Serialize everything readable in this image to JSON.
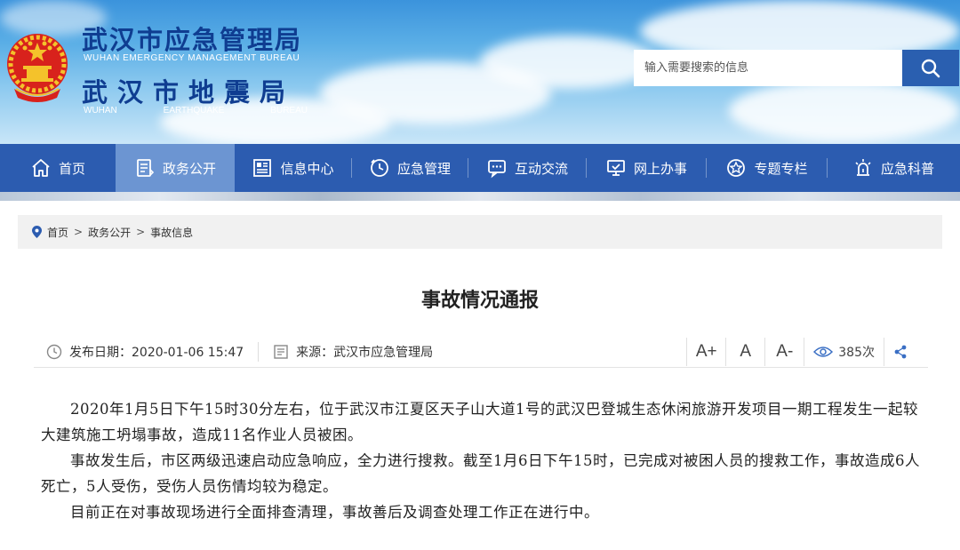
{
  "header": {
    "title_cn_1": "武汉市应急管理局",
    "title_en_1": "WUHAN EMERGENCY MANAGEMENT BUREAU",
    "title_cn_2": "武汉市地震局",
    "title_en_2": [
      "WUHAN",
      "EARTHQUAKE",
      "BUREAU"
    ],
    "emblem_icon": "national-emblem-icon"
  },
  "search": {
    "placeholder": "输入需要搜索的信息",
    "button_icon": "search-icon"
  },
  "nav": {
    "items": [
      {
        "label": "首页",
        "icon": "home-icon",
        "active": false
      },
      {
        "label": "政务公开",
        "icon": "document-icon",
        "active": true
      },
      {
        "label": "信息中心",
        "icon": "news-icon",
        "active": false
      },
      {
        "label": "应急管理",
        "icon": "clock-icon",
        "active": false
      },
      {
        "label": "互动交流",
        "icon": "chat-icon",
        "active": false
      },
      {
        "label": "网上办事",
        "icon": "monitor-check-icon",
        "active": false
      },
      {
        "label": "专题专栏",
        "icon": "star-badge-icon",
        "active": false
      },
      {
        "label": "应急科普",
        "icon": "siren-icon",
        "active": false
      }
    ]
  },
  "breadcrumb": {
    "items": [
      "首页",
      "政务公开",
      "事故信息"
    ],
    "separator": ">"
  },
  "article": {
    "title": "事故情况通报",
    "publish_label": "发布日期：",
    "publish_date": "2020-01-06 15:47",
    "source_label": "来源：",
    "source": "武汉市应急管理局",
    "font_sizes": [
      "A+",
      "A",
      "A-"
    ],
    "views": "385次",
    "paragraphs": [
      "2020年1月5日下午15时30分左右，位于武汉市江夏区天子山大道1号的武汉巴登城生态休闲旅游开发项目一期工程发生一起较大建筑施工坍塌事故，造成11名作业人员被困。",
      "事故发生后，市区两级迅速启动应急响应，全力进行搜救。截至1月6日下午15时，已完成对被困人员的搜救工作，事故造成6人死亡，5人受伤，受伤人员伤情均较为稳定。",
      "目前正在对事故现场进行全面排查清理，事故善后及调查处理工作正在进行中。"
    ]
  },
  "colors": {
    "nav_bg": "#2c5cb0",
    "nav_active": "#6c95d2",
    "title_blue": "#0f3d91",
    "search_button": "#2a5fb0"
  }
}
